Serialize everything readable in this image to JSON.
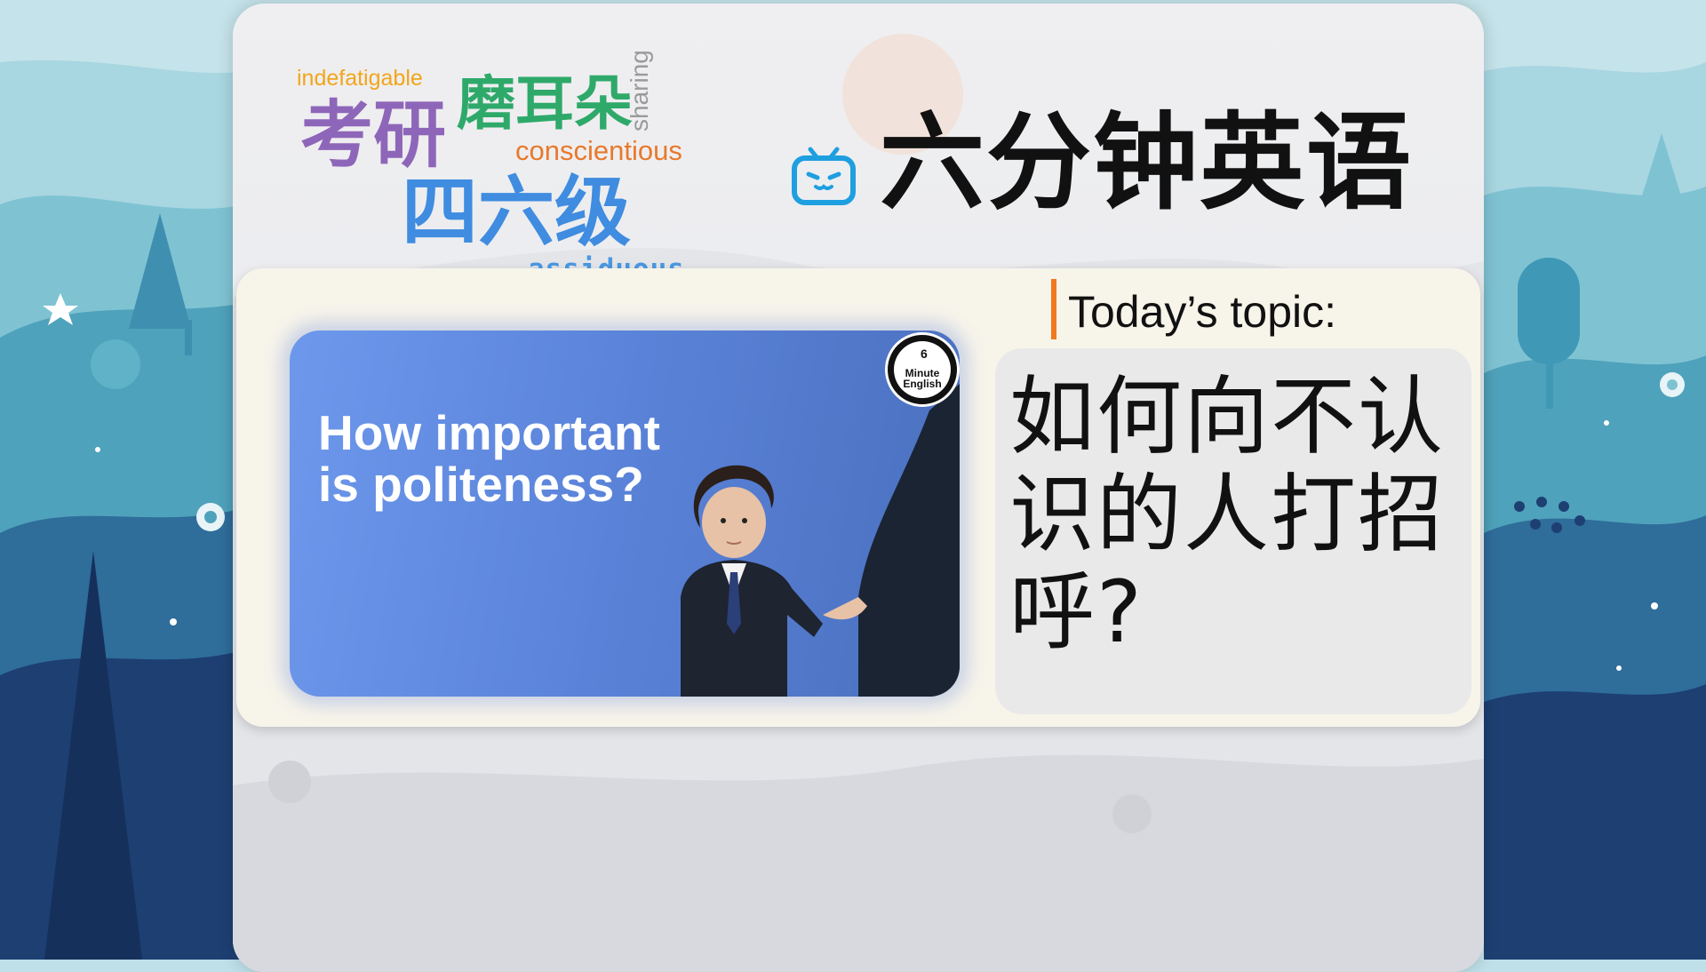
{
  "word_cloud": {
    "indefatigable": "indefatigable",
    "kaoyan": "考研",
    "moerduo": "磨耳朵",
    "conscientious": "conscientious",
    "siliuji": "四六级",
    "assiduous": "assiduous",
    "sharing": "sharing"
  },
  "header": {
    "icon": "bilibili-tv-icon",
    "title": "六分钟英语"
  },
  "thumbnail": {
    "title_line1": "How important",
    "title_line2": "is politeness?",
    "badge_number": "6",
    "badge_line1": "Minute",
    "badge_line2": "English"
  },
  "topic": {
    "label": "Today’s topic:",
    "question": "如何向不认识的人打招呼?"
  },
  "colors": {
    "accent_orange": "#f07a1e",
    "thumb_blue": "#5b84da",
    "panel_bg": "#ecedf0"
  }
}
